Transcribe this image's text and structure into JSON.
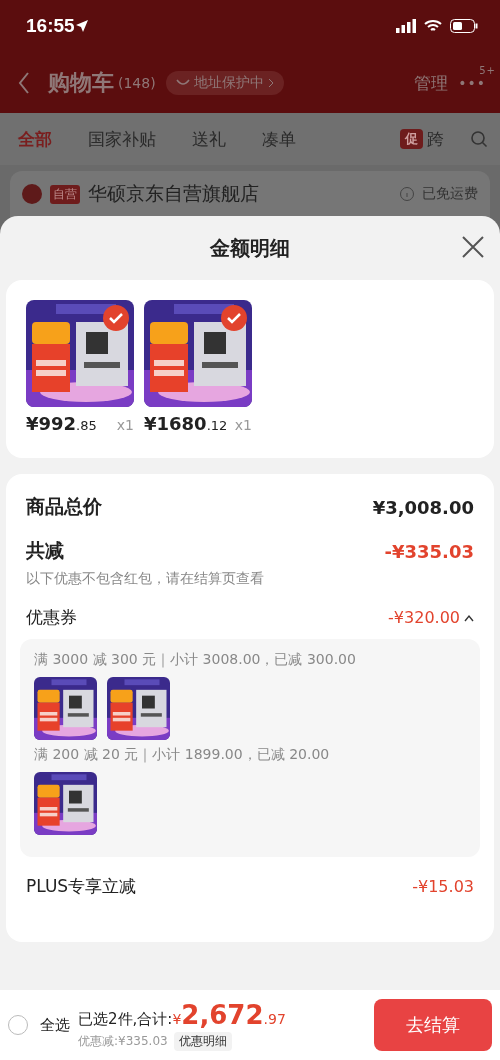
{
  "status_bar": {
    "time": "16:55"
  },
  "nav": {
    "title": "购物车",
    "count": "(148)",
    "address_pill": "地址保护中",
    "manage": "管理",
    "more": "•••",
    "badge": "5+"
  },
  "tabs": [
    {
      "label": "全部",
      "selected": true
    },
    {
      "label": "国家补贴",
      "selected": false
    },
    {
      "label": "送礼",
      "selected": false
    },
    {
      "label": "凑单",
      "selected": false
    },
    {
      "label": "跨",
      "selected": false,
      "tag": "促"
    }
  ],
  "store": {
    "checked": true,
    "tag": "自营",
    "name": "华硕京东自营旗舰店",
    "shipping": "已免运费"
  },
  "sheet": {
    "title": "金额明细",
    "products": [
      {
        "checked": true,
        "price": "¥992",
        "decimal": ".85",
        "qty": "x1"
      },
      {
        "checked": true,
        "price": "¥1680",
        "decimal": ".12",
        "qty": "x1"
      }
    ],
    "summary": [
      {
        "kind": "total",
        "label": "商品总价",
        "value": "¥3,008.00"
      },
      {
        "kind": "discount",
        "label": "共减",
        "value": "-¥335.03",
        "note": "以下优惠不包含红包，请在结算页查看"
      },
      {
        "kind": "coupon",
        "label": "优惠券",
        "value": "-¥320.00",
        "expanded": true,
        "groups": [
          {
            "text": "满 3000 减 300 元｜小计 3008.00，已减 300.00"
          },
          {
            "text": "满 200 减 20 元｜小计 1899.00，已减 20.00"
          }
        ]
      },
      {
        "kind": "plus",
        "label": "PLUS专享立减",
        "value": "-¥15.03"
      }
    ]
  },
  "bottom_bar": {
    "select_all": {
      "label": "全选",
      "checked": false
    },
    "selected_text": "已选2件,合计:",
    "currency": "¥",
    "total": "2,672",
    "decimal": ".97",
    "saved": "优惠减:¥335.03",
    "detail_button": "优惠明细",
    "checkout": "去结算"
  }
}
